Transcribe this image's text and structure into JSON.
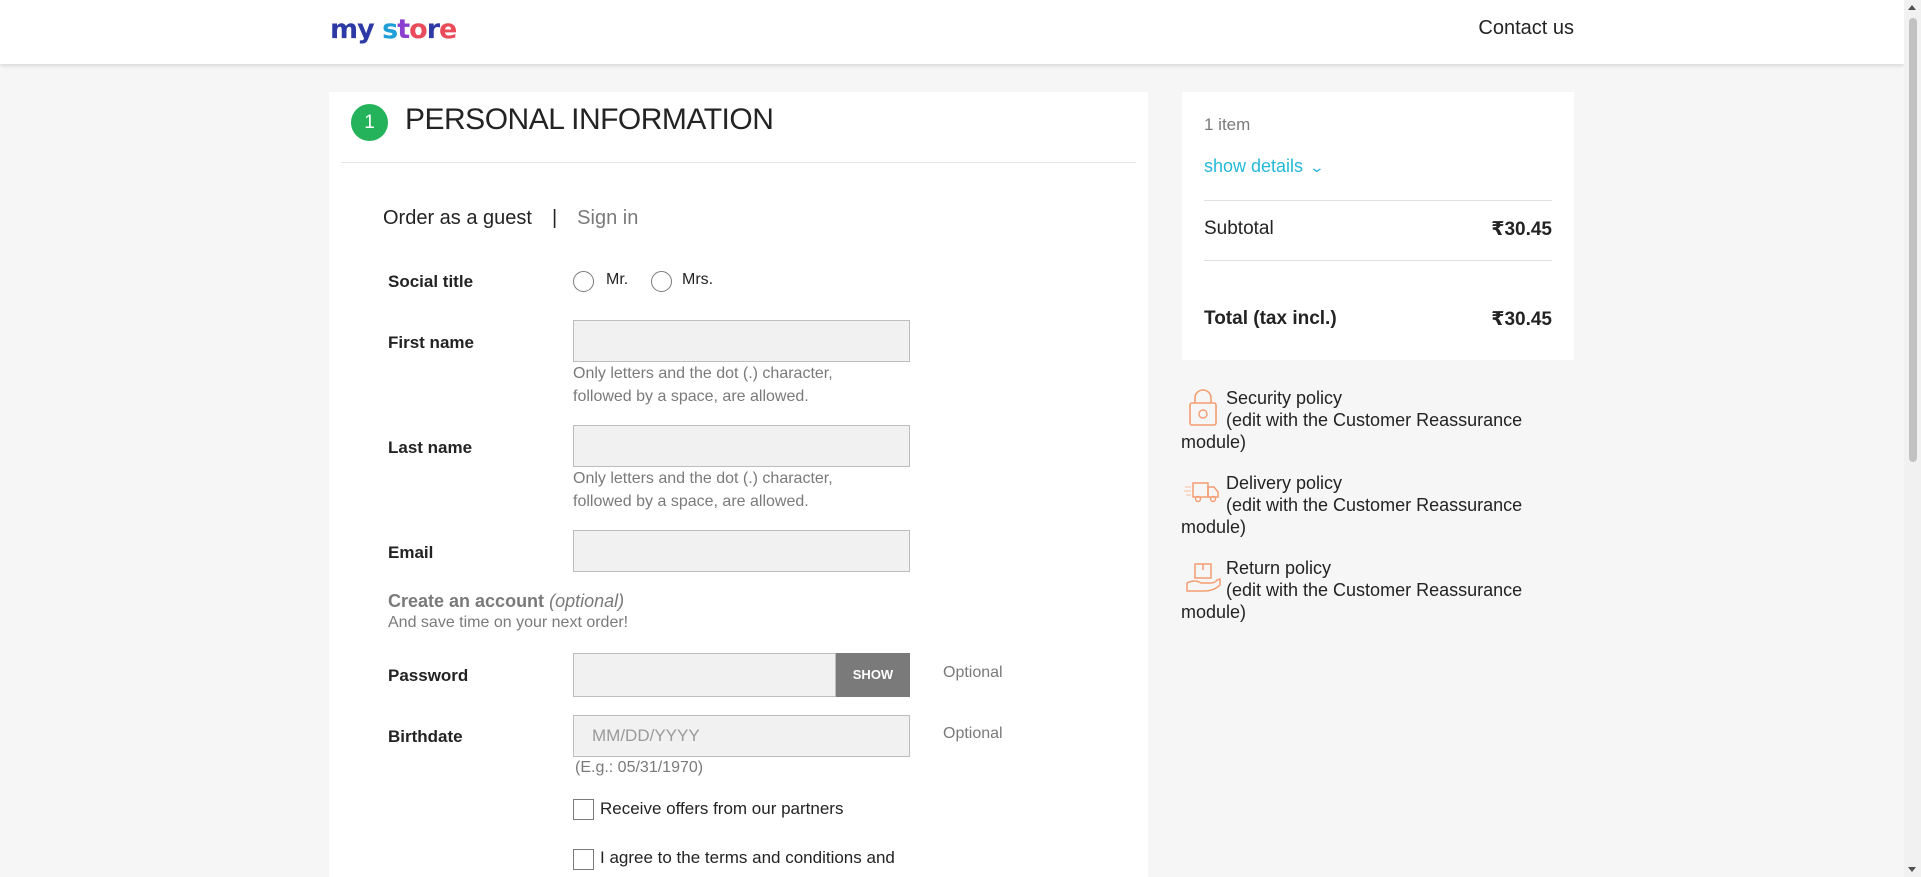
{
  "header": {
    "logo_parts": [
      "my",
      " ",
      "s",
      "t",
      "o",
      "r",
      "e"
    ],
    "contact_label": "Contact us"
  },
  "step": {
    "number": "1",
    "title": "PERSONAL INFORMATION"
  },
  "tabs": {
    "guest": "Order as a guest",
    "separator": "|",
    "signin": "Sign in"
  },
  "form": {
    "social_title_label": "Social title",
    "mr_label": "Mr.",
    "mrs_label": "Mrs.",
    "first_name_label": "First name",
    "first_name_hint_1": "Only letters and the dot (.) character,",
    "first_name_hint_2": "followed by a space, are allowed.",
    "last_name_label": "Last name",
    "last_name_hint_1": "Only letters and the dot (.) character,",
    "last_name_hint_2": "followed by a space, are allowed.",
    "email_label": "Email",
    "create_account_title": "Create an account",
    "create_account_optional": "(optional)",
    "create_account_sub": "And save time on your next order!",
    "password_label": "Password",
    "show_button": "SHOW",
    "password_optional": "Optional",
    "birthdate_label": "Birthdate",
    "birthdate_placeholder": "MM/DD/YYYY",
    "birthdate_optional": "Optional",
    "birthdate_hint": "(E.g.: 05/31/1970)",
    "offers_label": "Receive offers from our partners",
    "terms_label": "I agree to the terms and conditions and"
  },
  "summary": {
    "items_count": "1 item",
    "show_details": "show details",
    "subtotal_label": "Subtotal",
    "subtotal_value": "₹30.45",
    "total_label": "Total (tax incl.)",
    "total_value": "₹30.45"
  },
  "reassurance": [
    {
      "title": "Security policy",
      "sub": "(edit with the Customer Reassurance module)",
      "icon": "lock-icon"
    },
    {
      "title": "Delivery policy",
      "sub": "(edit with the Customer Reassurance module)",
      "icon": "delivery-truck-icon"
    },
    {
      "title": "Return policy",
      "sub": "(edit with the Customer Reassurance module)",
      "icon": "return-box-icon"
    }
  ],
  "colors": {
    "accent_green": "#24b35a",
    "link_blue": "#24b9d7",
    "icon_orange": "#f39d72"
  }
}
